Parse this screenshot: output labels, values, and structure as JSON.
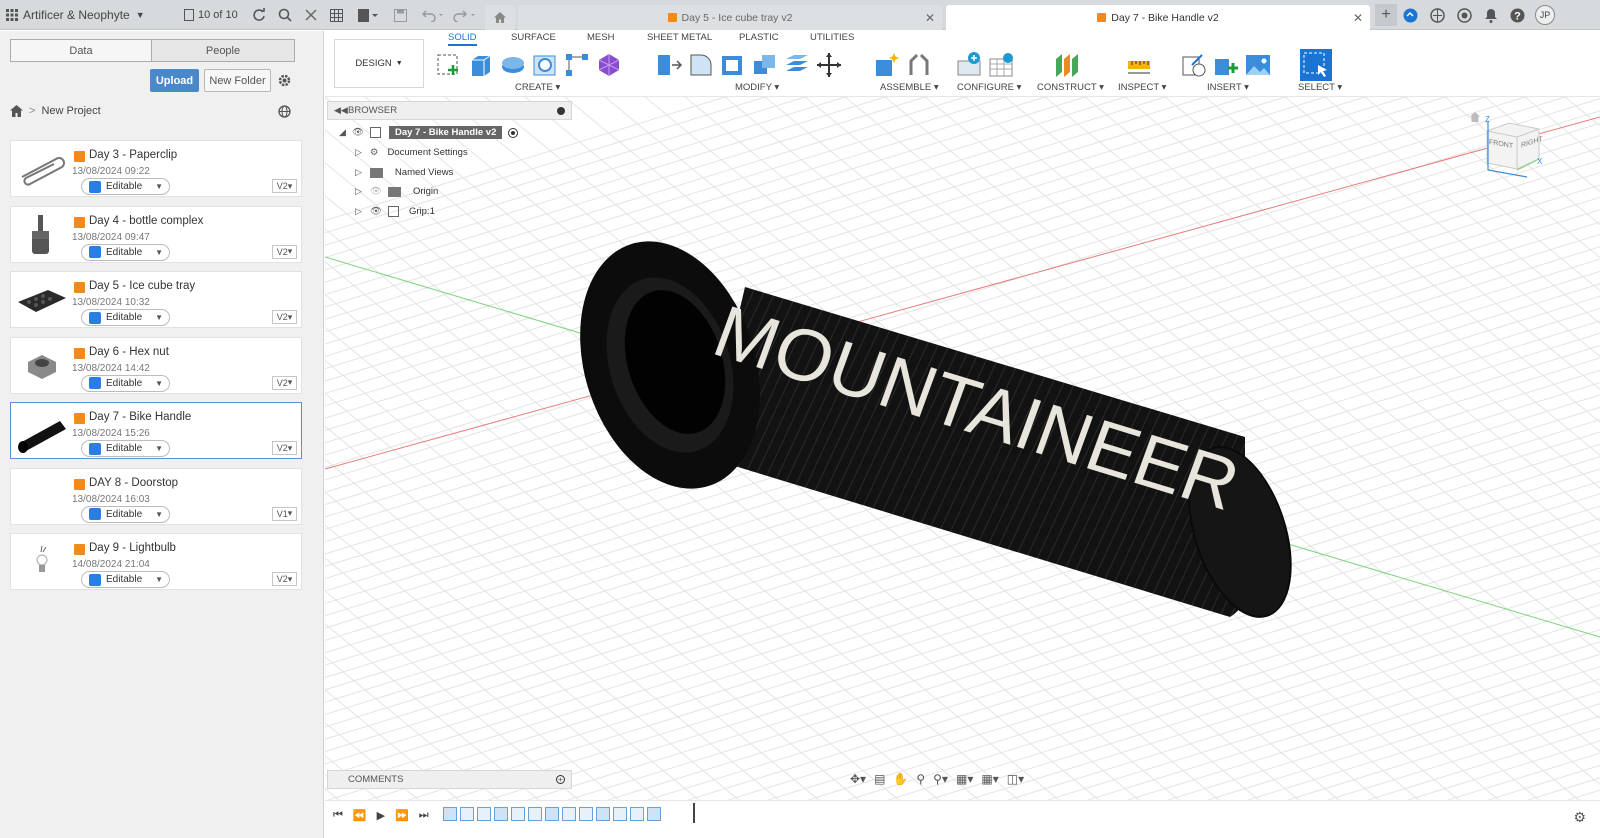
{
  "titlebar": {
    "app_name": "Artificer & Neophyte",
    "job_count": "10 of 10",
    "tabs": [
      {
        "label": "Day 5 - Ice cube tray v2",
        "active": false
      },
      {
        "label": "Day 7 - Bike Handle v2",
        "active": true
      }
    ],
    "user_initials": "JP"
  },
  "datapanel": {
    "tab_data": "Data",
    "tab_people": "People",
    "upload_label": "Upload",
    "new_folder_label": "New Folder",
    "breadcrumb": "New Project",
    "editable_label": "Editable",
    "files": [
      {
        "title": "Day 3 - Paperclip",
        "date": "13/08/2024 09:22",
        "version": "V2"
      },
      {
        "title": "Day 4 - bottle complex",
        "date": "13/08/2024 09:47",
        "version": "V2"
      },
      {
        "title": "Day 5 - Ice cube tray",
        "date": "13/08/2024 10:32",
        "version": "V2"
      },
      {
        "title": "Day 6 - Hex nut",
        "date": "13/08/2024 14:42",
        "version": "V2"
      },
      {
        "title": "Day 7 - Bike Handle",
        "date": "13/08/2024 15:26",
        "version": "V2",
        "selected": true
      },
      {
        "title": "DAY 8 - Doorstop",
        "date": "13/08/2024 16:03",
        "version": "V1"
      },
      {
        "title": "Day 9 - Lightbulb",
        "date": "14/08/2024 21:04",
        "version": "V2"
      }
    ]
  },
  "toolbar": {
    "workspace": "DESIGN",
    "tabs": [
      "SOLID",
      "SURFACE",
      "MESH",
      "SHEET METAL",
      "PLASTIC",
      "UTILITIES"
    ],
    "active_tab": "SOLID",
    "groups": [
      "CREATE",
      "MODIFY",
      "ASSEMBLE",
      "CONFIGURE",
      "CONSTRUCT",
      "INSPECT",
      "INSERT",
      "SELECT"
    ]
  },
  "browser": {
    "header": "BROWSER",
    "root": "Day 7 - Bike Handle v2",
    "items": [
      "Document Settings",
      "Named Views",
      "Origin",
      "Grip:1"
    ]
  },
  "comments": {
    "header": "COMMENTS"
  },
  "viewcube": {
    "front": "FRONT",
    "right": "RIGHT",
    "axis_z": "Z",
    "axis_x": "X"
  },
  "model": {
    "text": "MOUNTAINEER"
  }
}
